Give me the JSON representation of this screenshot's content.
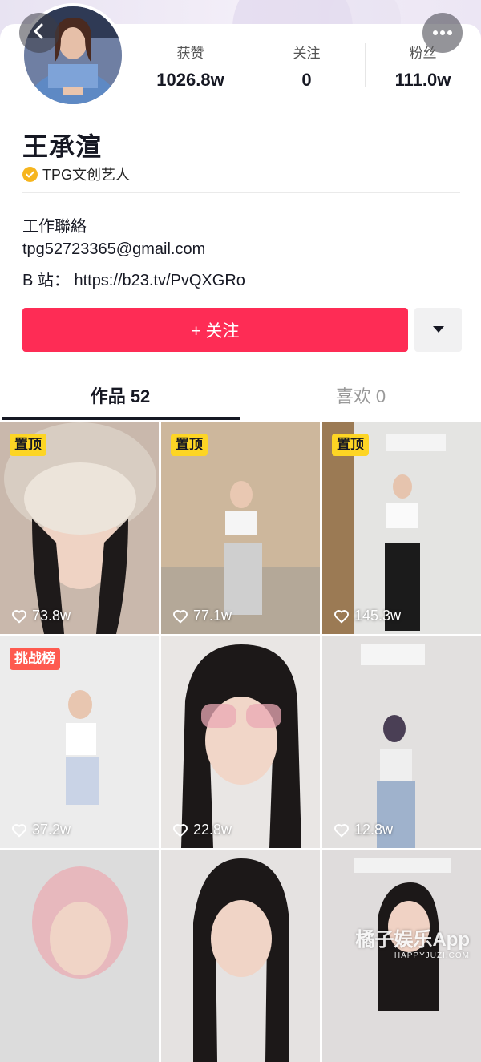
{
  "profile": {
    "stats": [
      {
        "label": "获赞",
        "value": "1026.8w"
      },
      {
        "label": "关注",
        "value": "0"
      },
      {
        "label": "粉丝",
        "value": "111.0w"
      }
    ],
    "name": "王承渲",
    "verified_label": "TPG文创艺人",
    "bio_lines": [
      "工作聯絡",
      "tpg52723365@gmail.com",
      "B 站：  https://b23.tv/PvQXGRo"
    ]
  },
  "actions": {
    "follow_label": "+ 关注"
  },
  "tabs": [
    {
      "label": "作品 52",
      "active": true
    },
    {
      "label": "喜欢 0",
      "active": false
    }
  ],
  "videos": [
    {
      "tag": "置顶",
      "likes": "73.8w"
    },
    {
      "tag": "置顶",
      "likes": "77.1w"
    },
    {
      "tag": "置顶",
      "likes": "145.3w"
    },
    {
      "tag": "挑战榜",
      "likes": "37.2w"
    },
    {
      "tag": "",
      "likes": "22.8w"
    },
    {
      "tag": "",
      "likes": "12.8w"
    },
    {
      "tag": "",
      "likes": ""
    },
    {
      "tag": "",
      "likes": ""
    },
    {
      "tag": "",
      "likes": ""
    }
  ],
  "watermark": {
    "line1": "橘子娱乐App",
    "line2": "HAPPYJUZI.COM"
  },
  "colors": {
    "accent": "#fe2c55",
    "pin_tag": "#fdd524",
    "challenge_tag": "#fe5a4f",
    "verify": "#f6b51e"
  },
  "icons": [
    "back-arrow-icon",
    "ellipsis-icon",
    "verified-check-icon",
    "caret-down-icon",
    "heart-outline-icon"
  ]
}
